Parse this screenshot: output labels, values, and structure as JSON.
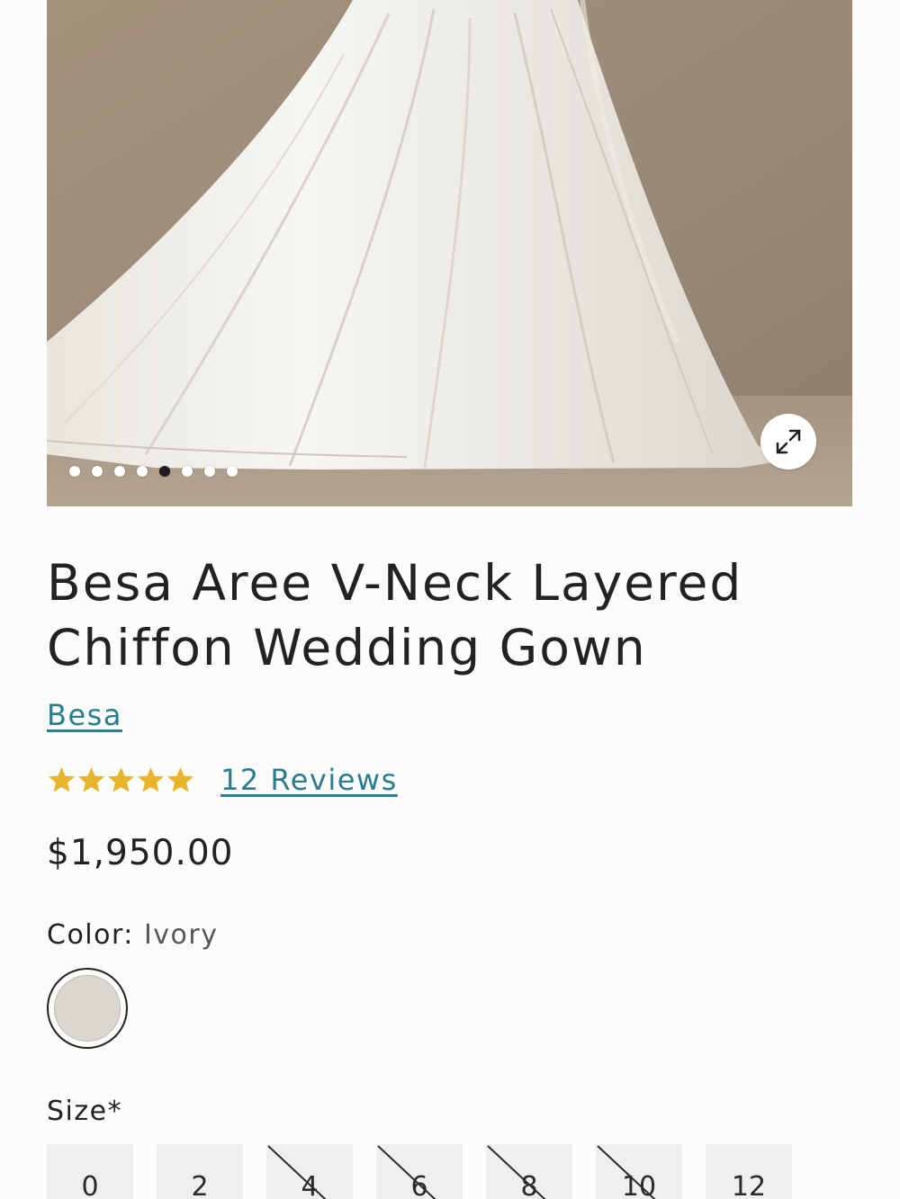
{
  "product": {
    "title": "Besa Aree V-Neck Layered Chiffon Wedding Gown",
    "brand": "Besa",
    "rating": 5,
    "reviews_label": "12 Reviews",
    "price": "$1,950.00"
  },
  "gallery": {
    "total_images": 8,
    "active_index": 4,
    "expand_icon": "expand-icon"
  },
  "color": {
    "label": "Color:",
    "value": "Ivory",
    "swatch_hex": "#dad6d0"
  },
  "size": {
    "label": "Size*",
    "options": [
      {
        "label": "0",
        "available": true
      },
      {
        "label": "2",
        "available": true
      },
      {
        "label": "4",
        "available": false
      },
      {
        "label": "6",
        "available": false
      },
      {
        "label": "8",
        "available": false
      },
      {
        "label": "10",
        "available": false
      },
      {
        "label": "12",
        "available": true
      }
    ]
  },
  "colors": {
    "link": "#2a7d8e",
    "star": "#e8b52a",
    "text": "#222225"
  }
}
